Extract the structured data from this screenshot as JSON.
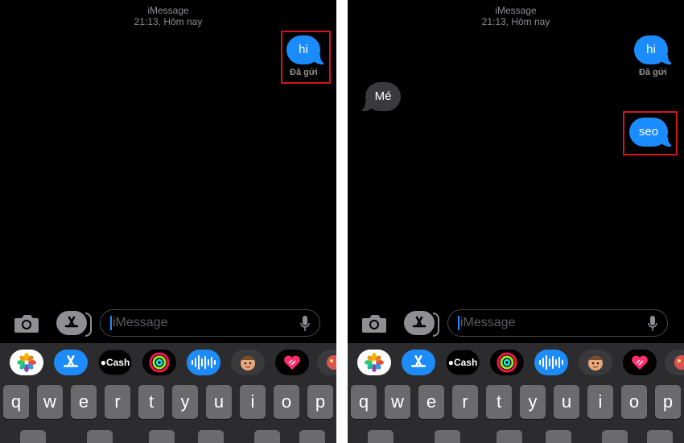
{
  "panels": [
    {
      "thread": {
        "service": "iMessage",
        "timestamp": "21:13, Hôm nay"
      },
      "messages": [
        {
          "kind": "sent",
          "text": "hi"
        }
      ],
      "delivered_label": "Đã gửi",
      "input": {
        "placeholder": "iMessage"
      },
      "keyboard_row": [
        "q",
        "w",
        "e",
        "r",
        "t",
        "y",
        "u",
        "i",
        "o",
        "p"
      ]
    },
    {
      "thread": {
        "service": "iMessage",
        "timestamp": "21:13, Hôm nay"
      },
      "messages": [
        {
          "kind": "sent",
          "text": "hi"
        },
        {
          "kind": "received",
          "text": "Mé"
        },
        {
          "kind": "sent",
          "text": "seo"
        }
      ],
      "delivered_label": "Đã gửi",
      "input": {
        "placeholder": "iMessage"
      },
      "keyboard_row": [
        "q",
        "w",
        "e",
        "r",
        "t",
        "y",
        "u",
        "i",
        "o",
        "p"
      ]
    }
  ],
  "app_tray": {
    "items": [
      "photos-icon",
      "app-store-icon",
      "apple-cash-icon",
      "fitness-icon",
      "audio-message-icon",
      "memoji-icon",
      "digital-touch-icon",
      "more-apps-icon"
    ],
    "cash_label": "Cash"
  },
  "colors": {
    "sent_bubble": "#1a8cff",
    "received_bubble": "#3a3a3c",
    "highlight": "#d0161c",
    "background": "#000000"
  }
}
